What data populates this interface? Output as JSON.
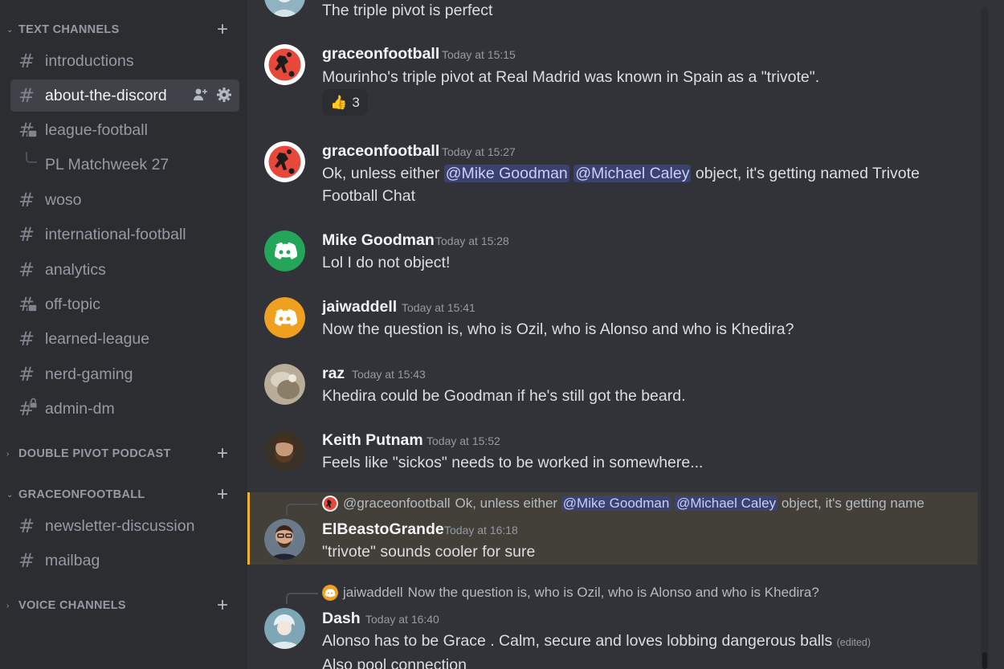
{
  "sidebar": {
    "categories": [
      {
        "label": "TEXT CHANNELS",
        "expanded": true
      },
      {
        "label": "DOUBLE PIVOT PODCAST",
        "expanded": false
      },
      {
        "label": "GRACEONFOOTBALL",
        "expanded": true
      },
      {
        "label": "VOICE CHANNELS",
        "expanded": false
      }
    ],
    "channels": [
      {
        "name": "introductions",
        "icon": "hash-icon"
      },
      {
        "name": "about-the-discord",
        "icon": "hash-icon",
        "active": true
      },
      {
        "name": "league-football",
        "icon": "forum-hash-icon"
      },
      {
        "name": "PL Matchweek 27",
        "icon": "thread-branch-icon"
      },
      {
        "name": "woso",
        "icon": "hash-icon"
      },
      {
        "name": "international-football",
        "icon": "hash-icon"
      },
      {
        "name": "analytics",
        "icon": "hash-icon"
      },
      {
        "name": "off-topic",
        "icon": "forum-hash-icon"
      },
      {
        "name": "learned-league",
        "icon": "hash-icon"
      },
      {
        "name": "nerd-gaming",
        "icon": "hash-icon"
      },
      {
        "name": "admin-dm",
        "icon": "locked-hash-icon"
      },
      {
        "name": "newsletter-discussion",
        "icon": "hash-icon"
      },
      {
        "name": "mailbag",
        "icon": "hash-icon"
      }
    ]
  },
  "messages": [
    {
      "author": "",
      "time": "",
      "text": "The triple pivot is perfect"
    },
    {
      "author": "graceonfootball",
      "time": "Today at 15:15",
      "text": "Mourinho's triple pivot at Real Madrid was known in Spain as a \"trivote\".",
      "reaction": {
        "emoji": "👍",
        "count": "3"
      }
    },
    {
      "author": "graceonfootball",
      "time": "Today at 15:27",
      "text_pre": "Ok, unless either ",
      "mention1": "@Mike Goodman",
      "mention2": "@Michael Caley",
      "text_post": " object, it's getting named Trivote Football Chat"
    },
    {
      "author": "Mike Goodman",
      "time": "Today at 15:28",
      "text": "Lol I do not object!"
    },
    {
      "author": "jaiwaddell",
      "time": "Today at 15:41",
      "text": "Now the question is, who is Ozil, who is Alonso and who is Khedira?"
    },
    {
      "author": "raz",
      "time": "Today at 15:43",
      "text": "Khedira could be Goodman if he's still got the beard."
    },
    {
      "author": "Keith Putnam",
      "time": "Today at 15:52",
      "text": "Feels like \"sickos\" needs to be worked in somewhere..."
    },
    {
      "author": "ElBeastoGrande",
      "time": "Today at 16:18",
      "text": "\"trivote\" sounds cooler for sure",
      "reply": {
        "user": "@graceonfootball",
        "pre": "Ok, unless either ",
        "mention1": "@Mike Goodman",
        "mention2": "@Michael Caley",
        "post": " object, it's getting name"
      }
    },
    {
      "author": "Dash",
      "time": "Today at 16:40",
      "text": "Alonso has to be Grace . Calm, secure and loves lobbing dangerous balls",
      "edited": "(edited)",
      "text2": "Also pool connection",
      "reply": {
        "user": "jaiwaddell",
        "text": "Now the question is, who is Ozil, who is Alonso and who is Khedira?"
      }
    }
  ],
  "colors": {
    "accent_mention": "#3c4270",
    "highlight_bar": "#f0b232",
    "discord_green": "#23a55a",
    "discord_orange": "#f0a020",
    "grace_red": "#e8483a"
  }
}
